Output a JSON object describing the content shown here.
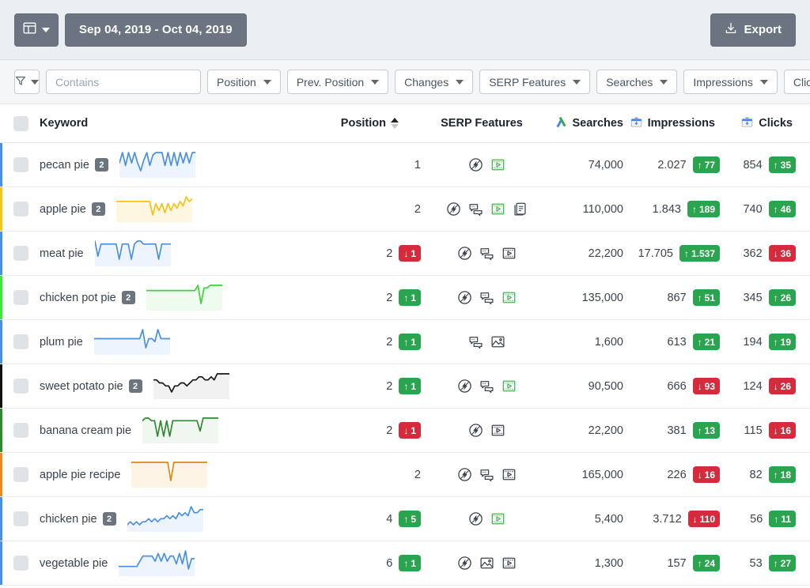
{
  "toolbar": {
    "view_icon": "layout-columns-icon",
    "date_range": "Sep 04, 2019 - Oct 04, 2019",
    "export_label": "Export",
    "export_icon": "download-icon"
  },
  "filters": {
    "filter_icon": "funnel-icon",
    "search_placeholder": "Contains",
    "search_value": "",
    "chips": [
      {
        "label": "Position"
      },
      {
        "label": "Prev. Position"
      },
      {
        "label": "Changes"
      },
      {
        "label": "SERP Features"
      },
      {
        "label": "Searches"
      },
      {
        "label": "Impressions"
      },
      {
        "label": "Clicks"
      }
    ]
  },
  "table": {
    "columns": {
      "keyword": "Keyword",
      "position": "Position",
      "serp_features": "SERP Features",
      "searches": "Searches",
      "impressions": "Impressions",
      "clicks": "Clicks"
    },
    "sort": {
      "column": "Position",
      "direction": "asc"
    },
    "header_icons": {
      "searches": "google-ads-icon",
      "impressions": "google-search-console-icon",
      "clicks": "google-search-console-icon"
    },
    "rows": [
      {
        "keyword": "pecan pie",
        "badge": "2",
        "edge_color": "#4a90e2",
        "spark_color": "#4a90e2",
        "spark_fill": "#eef4fd",
        "spark": [
          6,
          2,
          7,
          2,
          6,
          2,
          6,
          9,
          5,
          2,
          7,
          3,
          2,
          2,
          2,
          7,
          2,
          7,
          2,
          7,
          2,
          6,
          2,
          6,
          2,
          2
        ],
        "position": "1",
        "pos_badge": null,
        "serp": [
          "amp",
          "video-green"
        ],
        "searches": "74,000",
        "impressions": "2.027",
        "impressions_badge": {
          "dir": "up",
          "value": "77"
        },
        "clicks": "854",
        "clicks_badge": {
          "dir": "up",
          "value": "35"
        }
      },
      {
        "keyword": "apple pie",
        "badge": "2",
        "edge_color": "#f5c518",
        "spark_color": "#f6c116",
        "spark_fill": "#fdf6e0",
        "spark": [
          4,
          4,
          4,
          4,
          4,
          4,
          4,
          4,
          4,
          4,
          4,
          4,
          10,
          5,
          8,
          5,
          9,
          5,
          8,
          5,
          7,
          4,
          6,
          2,
          4,
          3
        ],
        "position": "2",
        "pos_badge": null,
        "serp": [
          "amp",
          "faq",
          "video-green",
          "reviews"
        ],
        "searches": "110,000",
        "impressions": "1.843",
        "impressions_badge": {
          "dir": "up",
          "value": "189"
        },
        "clicks": "740",
        "clicks_badge": {
          "dir": "up",
          "value": "46"
        }
      },
      {
        "keyword": "meat pie",
        "badge": null,
        "edge_color": "#4a90e2",
        "spark_color": "#4a90e2",
        "spark_fill": "#eef4fd",
        "spark": [
          2,
          7,
          3,
          3,
          3,
          3,
          3,
          3,
          8,
          3,
          3,
          3,
          8,
          3,
          2,
          2,
          3,
          3,
          3,
          3,
          3,
          8,
          3,
          3,
          3,
          3
        ],
        "position": "2",
        "pos_badge": {
          "dir": "down",
          "value": "1"
        },
        "serp": [
          "amp",
          "faq",
          "video-dark"
        ],
        "searches": "22,200",
        "impressions": "17.705",
        "impressions_badge": {
          "dir": "up",
          "value": "1.537"
        },
        "clicks": "362",
        "clicks_badge": {
          "dir": "down",
          "value": "36"
        }
      },
      {
        "keyword": "chicken pot pie",
        "badge": "2",
        "edge_color": "#3ae83a",
        "spark_color": "#3ad13a",
        "spark_fill": "#effbef",
        "spark": [
          4,
          4,
          4,
          4,
          4,
          4,
          4,
          4,
          4,
          4,
          4,
          4,
          4,
          4,
          4,
          4,
          4,
          2,
          9,
          3,
          3,
          2,
          2,
          2,
          2,
          2
        ],
        "position": "2",
        "pos_badge": {
          "dir": "up",
          "value": "1"
        },
        "serp": [
          "amp",
          "faq",
          "video-green"
        ],
        "searches": "135,000",
        "impressions": "867",
        "impressions_badge": {
          "dir": "up",
          "value": "51"
        },
        "clicks": "345",
        "clicks_badge": {
          "dir": "up",
          "value": "26"
        }
      },
      {
        "keyword": "plum pie",
        "badge": null,
        "edge_color": "#4a90e2",
        "spark_color": "#4a90e2",
        "spark_fill": "#eef4fd",
        "spark": [
          5,
          5,
          5,
          5,
          5,
          5,
          5,
          5,
          5,
          5,
          5,
          5,
          5,
          5,
          5,
          5,
          2,
          8,
          5,
          5,
          6,
          2,
          5,
          5,
          5,
          5
        ],
        "position": "2",
        "pos_badge": {
          "dir": "up",
          "value": "1"
        },
        "serp": [
          "faq",
          "image"
        ],
        "searches": "1,600",
        "impressions": "613",
        "impressions_badge": {
          "dir": "up",
          "value": "21"
        },
        "clicks": "194",
        "clicks_badge": {
          "dir": "up",
          "value": "19"
        }
      },
      {
        "keyword": "sweet potato pie",
        "badge": "2",
        "edge_color": "#111111",
        "spark_color": "#18191a",
        "spark_fill": "#f1f1f1",
        "spark": [
          4,
          4,
          5,
          5,
          6,
          6,
          8,
          6,
          6,
          5,
          5,
          6,
          5,
          4,
          4,
          3,
          3,
          4,
          4,
          3,
          4,
          2,
          2,
          2,
          2,
          2
        ],
        "position": "2",
        "pos_badge": {
          "dir": "up",
          "value": "1"
        },
        "serp": [
          "amp",
          "faq",
          "video-green"
        ],
        "searches": "90,500",
        "impressions": "666",
        "impressions_badge": {
          "dir": "down",
          "value": "93"
        },
        "clicks": "124",
        "clicks_badge": {
          "dir": "down",
          "value": "26"
        }
      },
      {
        "keyword": "banana cream pie",
        "badge": null,
        "edge_color": "#2f8a2f",
        "spark_color": "#2f8a2f",
        "spark_fill": "#f0f7f0",
        "spark": [
          3,
          2,
          2,
          3,
          3,
          9,
          3,
          9,
          3,
          9,
          3,
          3,
          3,
          3,
          3,
          3,
          3,
          3,
          3,
          7,
          2,
          2,
          2,
          2,
          2,
          2
        ],
        "position": "2",
        "pos_badge": {
          "dir": "down",
          "value": "1"
        },
        "serp": [
          "amp",
          "video-dark"
        ],
        "searches": "22,200",
        "impressions": "381",
        "impressions_badge": {
          "dir": "up",
          "value": "13"
        },
        "clicks": "115",
        "clicks_badge": {
          "dir": "down",
          "value": "16"
        }
      },
      {
        "keyword": "apple pie recipe",
        "badge": null,
        "edge_color": "#e58b20",
        "spark_color": "#d98a1a",
        "spark_fill": "#fdf4e6",
        "spark": [
          3,
          3,
          3,
          3,
          3,
          3,
          3,
          3,
          3,
          3,
          3,
          3,
          3,
          9,
          3,
          3,
          3,
          3,
          3,
          3,
          3,
          3,
          3,
          3,
          3,
          3
        ],
        "position": "2",
        "pos_badge": null,
        "serp": [
          "amp",
          "faq",
          "video-dark"
        ],
        "searches": "165,000",
        "impressions": "226",
        "impressions_badge": {
          "dir": "down",
          "value": "16"
        },
        "clicks": "82",
        "clicks_badge": {
          "dir": "up",
          "value": "18"
        }
      },
      {
        "keyword": "chicken pie",
        "badge": "2",
        "edge_color": "#4a90e2",
        "spark_color": "#4a90e2",
        "spark_fill": "#eef4fd",
        "spark": [
          8,
          7,
          8,
          7,
          8,
          7,
          7,
          6,
          7,
          6,
          7,
          6,
          6,
          5,
          6,
          5,
          6,
          4,
          5,
          4,
          5,
          2,
          4,
          4,
          3,
          3
        ],
        "position": "4",
        "pos_badge": {
          "dir": "up",
          "value": "5"
        },
        "serp": [
          "amp",
          "video-green"
        ],
        "searches": "5,400",
        "impressions": "3.712",
        "impressions_badge": {
          "dir": "down",
          "value": "110"
        },
        "clicks": "56",
        "clicks_badge": {
          "dir": "up",
          "value": "11"
        }
      },
      {
        "keyword": "vegetable pie",
        "badge": null,
        "edge_color": "#4a90e2",
        "spark_color": "#4a90e2",
        "spark_fill": "#eef4fd",
        "spark": [
          8,
          8,
          8,
          8,
          8,
          8,
          8,
          6,
          4,
          4,
          4,
          4,
          6,
          3,
          6,
          3,
          6,
          4,
          4,
          7,
          3,
          7,
          2,
          9,
          5,
          5
        ],
        "position": "6",
        "pos_badge": {
          "dir": "up",
          "value": "1"
        },
        "serp": [
          "amp",
          "image",
          "video-dark"
        ],
        "searches": "1,300",
        "impressions": "157",
        "impressions_badge": {
          "dir": "up",
          "value": "24"
        },
        "clicks": "53",
        "clicks_badge": {
          "dir": "up",
          "value": "27"
        }
      }
    ]
  }
}
